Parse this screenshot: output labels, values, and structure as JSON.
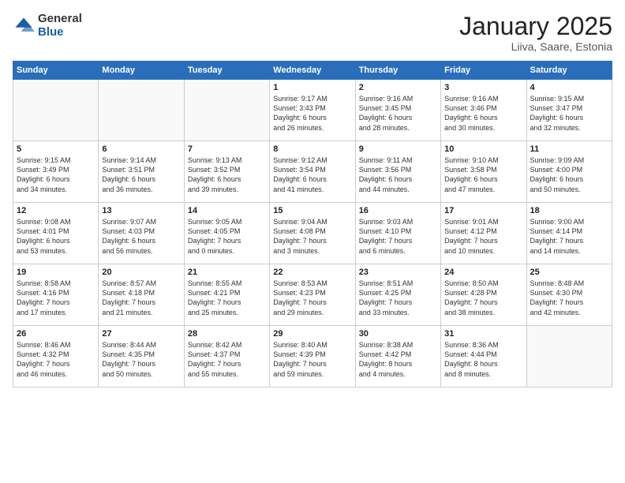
{
  "logo": {
    "general": "General",
    "blue": "Blue"
  },
  "header": {
    "title": "January 2025",
    "subtitle": "Liiva, Saare, Estonia"
  },
  "weekdays": [
    "Sunday",
    "Monday",
    "Tuesday",
    "Wednesday",
    "Thursday",
    "Friday",
    "Saturday"
  ],
  "weeks": [
    [
      {
        "day": "",
        "info": ""
      },
      {
        "day": "",
        "info": ""
      },
      {
        "day": "",
        "info": ""
      },
      {
        "day": "1",
        "info": "Sunrise: 9:17 AM\nSunset: 3:43 PM\nDaylight: 6 hours\nand 26 minutes."
      },
      {
        "day": "2",
        "info": "Sunrise: 9:16 AM\nSunset: 3:45 PM\nDaylight: 6 hours\nand 28 minutes."
      },
      {
        "day": "3",
        "info": "Sunrise: 9:16 AM\nSunset: 3:46 PM\nDaylight: 6 hours\nand 30 minutes."
      },
      {
        "day": "4",
        "info": "Sunrise: 9:15 AM\nSunset: 3:47 PM\nDaylight: 6 hours\nand 32 minutes."
      }
    ],
    [
      {
        "day": "5",
        "info": "Sunrise: 9:15 AM\nSunset: 3:49 PM\nDaylight: 6 hours\nand 34 minutes."
      },
      {
        "day": "6",
        "info": "Sunrise: 9:14 AM\nSunset: 3:51 PM\nDaylight: 6 hours\nand 36 minutes."
      },
      {
        "day": "7",
        "info": "Sunrise: 9:13 AM\nSunset: 3:52 PM\nDaylight: 6 hours\nand 39 minutes."
      },
      {
        "day": "8",
        "info": "Sunrise: 9:12 AM\nSunset: 3:54 PM\nDaylight: 6 hours\nand 41 minutes."
      },
      {
        "day": "9",
        "info": "Sunrise: 9:11 AM\nSunset: 3:56 PM\nDaylight: 6 hours\nand 44 minutes."
      },
      {
        "day": "10",
        "info": "Sunrise: 9:10 AM\nSunset: 3:58 PM\nDaylight: 6 hours\nand 47 minutes."
      },
      {
        "day": "11",
        "info": "Sunrise: 9:09 AM\nSunset: 4:00 PM\nDaylight: 6 hours\nand 50 minutes."
      }
    ],
    [
      {
        "day": "12",
        "info": "Sunrise: 9:08 AM\nSunset: 4:01 PM\nDaylight: 6 hours\nand 53 minutes."
      },
      {
        "day": "13",
        "info": "Sunrise: 9:07 AM\nSunset: 4:03 PM\nDaylight: 6 hours\nand 56 minutes."
      },
      {
        "day": "14",
        "info": "Sunrise: 9:05 AM\nSunset: 4:05 PM\nDaylight: 7 hours\nand 0 minutes."
      },
      {
        "day": "15",
        "info": "Sunrise: 9:04 AM\nSunset: 4:08 PM\nDaylight: 7 hours\nand 3 minutes."
      },
      {
        "day": "16",
        "info": "Sunrise: 9:03 AM\nSunset: 4:10 PM\nDaylight: 7 hours\nand 6 minutes."
      },
      {
        "day": "17",
        "info": "Sunrise: 9:01 AM\nSunset: 4:12 PM\nDaylight: 7 hours\nand 10 minutes."
      },
      {
        "day": "18",
        "info": "Sunrise: 9:00 AM\nSunset: 4:14 PM\nDaylight: 7 hours\nand 14 minutes."
      }
    ],
    [
      {
        "day": "19",
        "info": "Sunrise: 8:58 AM\nSunset: 4:16 PM\nDaylight: 7 hours\nand 17 minutes."
      },
      {
        "day": "20",
        "info": "Sunrise: 8:57 AM\nSunset: 4:18 PM\nDaylight: 7 hours\nand 21 minutes."
      },
      {
        "day": "21",
        "info": "Sunrise: 8:55 AM\nSunset: 4:21 PM\nDaylight: 7 hours\nand 25 minutes."
      },
      {
        "day": "22",
        "info": "Sunrise: 8:53 AM\nSunset: 4:23 PM\nDaylight: 7 hours\nand 29 minutes."
      },
      {
        "day": "23",
        "info": "Sunrise: 8:51 AM\nSunset: 4:25 PM\nDaylight: 7 hours\nand 33 minutes."
      },
      {
        "day": "24",
        "info": "Sunrise: 8:50 AM\nSunset: 4:28 PM\nDaylight: 7 hours\nand 38 minutes."
      },
      {
        "day": "25",
        "info": "Sunrise: 8:48 AM\nSunset: 4:30 PM\nDaylight: 7 hours\nand 42 minutes."
      }
    ],
    [
      {
        "day": "26",
        "info": "Sunrise: 8:46 AM\nSunset: 4:32 PM\nDaylight: 7 hours\nand 46 minutes."
      },
      {
        "day": "27",
        "info": "Sunrise: 8:44 AM\nSunset: 4:35 PM\nDaylight: 7 hours\nand 50 minutes."
      },
      {
        "day": "28",
        "info": "Sunrise: 8:42 AM\nSunset: 4:37 PM\nDaylight: 7 hours\nand 55 minutes."
      },
      {
        "day": "29",
        "info": "Sunrise: 8:40 AM\nSunset: 4:39 PM\nDaylight: 7 hours\nand 59 minutes."
      },
      {
        "day": "30",
        "info": "Sunrise: 8:38 AM\nSunset: 4:42 PM\nDaylight: 8 hours\nand 4 minutes."
      },
      {
        "day": "31",
        "info": "Sunrise: 8:36 AM\nSunset: 4:44 PM\nDaylight: 8 hours\nand 8 minutes."
      },
      {
        "day": "",
        "info": ""
      }
    ]
  ]
}
